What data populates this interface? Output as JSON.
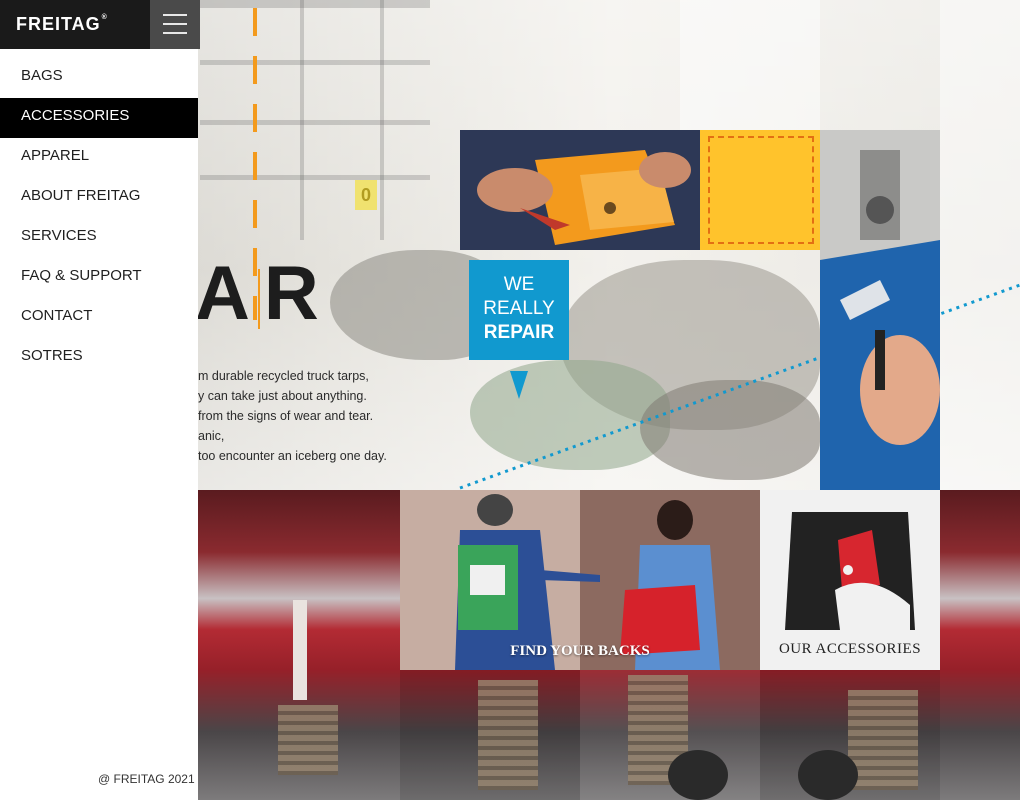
{
  "brand": {
    "logo_text": "FREITAG",
    "logo_mark": "®"
  },
  "sidebar": {
    "menu_icon": "hamburger-icon",
    "items": [
      {
        "label": "BAGS",
        "active": false
      },
      {
        "label": "ACCESSORIES",
        "active": true
      },
      {
        "label": "APPAREL",
        "active": false
      },
      {
        "label": "ABOUT FREITAG",
        "active": false
      },
      {
        "label": "SERVICES",
        "active": false
      },
      {
        "label": "FAQ & SUPPORT",
        "active": false
      },
      {
        "label": "CONTACT",
        "active": false
      },
      {
        "label": "SOTRES",
        "active": false
      }
    ],
    "copyright": "@ FREITAG 2021"
  },
  "hero": {
    "big_word": "AR",
    "small_tag": "0",
    "text_lines": [
      "m durable recycled truck tarps,",
      "y can take just about anything.",
      "from the signs of wear and tear.",
      "anic,",
      "too encounter an iceberg one day."
    ],
    "repair_box": {
      "line1": "WE",
      "line2": "REALLY",
      "line3": "REPAIR"
    }
  },
  "cards": {
    "backs_label": "FIND YOUR BACKS",
    "accessories_label": "OUR ACCESSORIES"
  },
  "colors": {
    "accent_blue": "#1199cf",
    "accent_yellow": "#ffc32c",
    "accent_orange": "#f39a1d",
    "nav_active_bg": "#000000"
  }
}
